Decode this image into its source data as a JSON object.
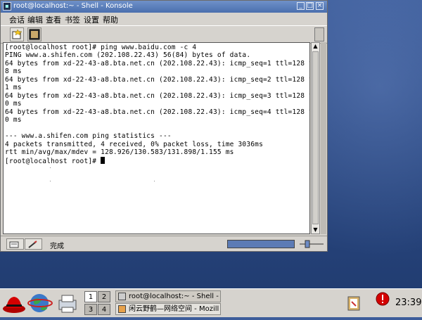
{
  "window": {
    "title": "root@localhost:~ - Shell - Konsole",
    "menu": [
      "会话",
      "编辑",
      "查看",
      "书签",
      "设置",
      "帮助"
    ]
  },
  "terminal": {
    "lines": [
      "[root@localhost root]# ping www.baidu.com -c 4",
      "PING www.a.shifen.com (202.108.22.43) 56(84) bytes of data.",
      "64 bytes from xd-22-43-a8.bta.net.cn (202.108.22.43): icmp_seq=1 ttl=128 time=12",
      "8 ms",
      "64 bytes from xd-22-43-a8.bta.net.cn (202.108.22.43): icmp_seq=2 ttl=128 time=13",
      "1 ms",
      "64 bytes from xd-22-43-a8.bta.net.cn (202.108.22.43): icmp_seq=3 ttl=128 time=13",
      "0 ms",
      "64 bytes from xd-22-43-a8.bta.net.cn (202.108.22.43): icmp_seq=4 ttl=128 time=13",
      "0 ms",
      "",
      "--- www.a.shifen.com ping statistics ---",
      "4 packets transmitted, 4 received, 0% packet loss, time 3036ms",
      "rtt min/avg/max/mdev = 128.926/130.583/131.898/1.155 ms",
      "[root@localhost root]# "
    ]
  },
  "statusbar": {
    "text": "完成"
  },
  "taskbar": {
    "pager": [
      "1",
      "2",
      "3",
      "4"
    ],
    "tasks": [
      "root@localhost:~ - Shell - Konso",
      "闲云野鹤—网络空间 - Mozill"
    ],
    "clock": "23:39"
  },
  "colors": {
    "desktop": "#2e4c86",
    "titlebar": "#4a6fae",
    "window_bg": "#d6d3ce"
  }
}
